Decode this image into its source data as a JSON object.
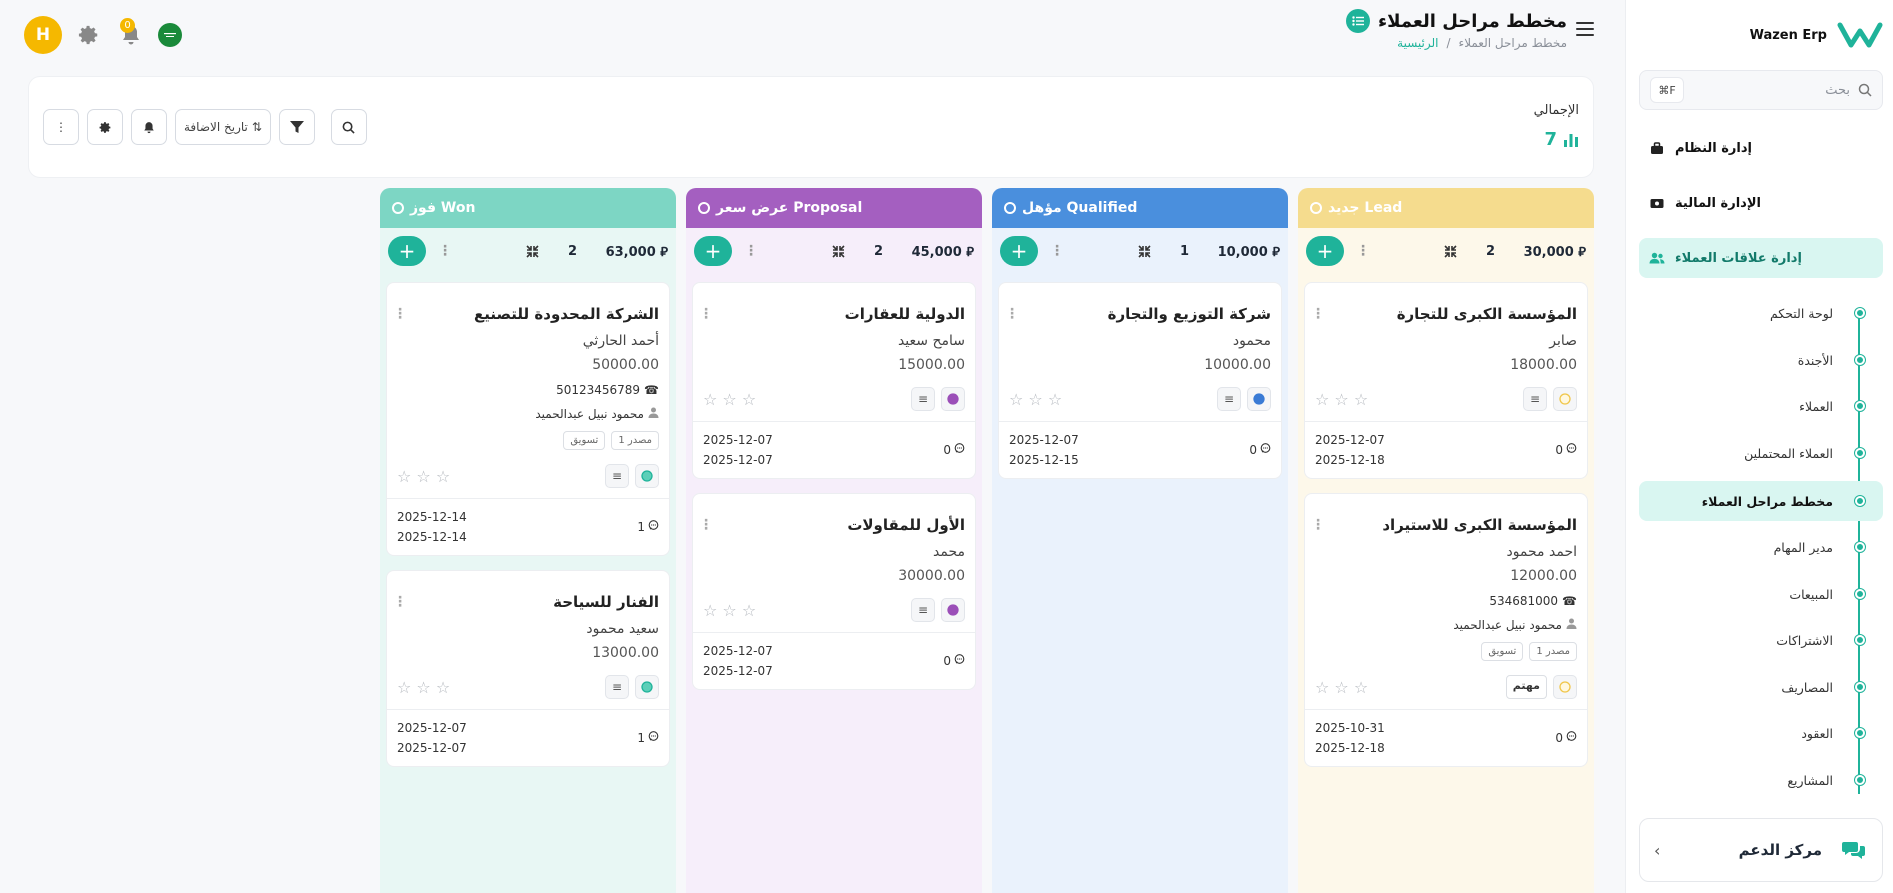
{
  "sidebar": {
    "brand": "Wazen Erp",
    "search_placeholder": "بحث",
    "shortcut": "⌘F",
    "sections": [
      {
        "label": "إدارة النظام"
      },
      {
        "label": "الإدارة المالية"
      },
      {
        "label": "إدارة علاقات العملاء"
      }
    ],
    "items": [
      {
        "label": "لوحة التحكم"
      },
      {
        "label": "الأجندة"
      },
      {
        "label": "العملاء"
      },
      {
        "label": "العملاء المحتملين"
      },
      {
        "label": "مخطط مراحل العملاء"
      },
      {
        "label": "مدير المهام"
      },
      {
        "label": "المبيعات"
      },
      {
        "label": "الاشتراكات"
      },
      {
        "label": "المصاريف"
      },
      {
        "label": "العقود"
      },
      {
        "label": "المشاريع"
      }
    ],
    "support": "مركز الدعم"
  },
  "header": {
    "title": "مخطط مراحل العملاء",
    "breadcrumb": {
      "home": "الرئيسية",
      "sep": "/",
      "current": "مخطط مراحل العملاء"
    },
    "avatar": "H",
    "notifications": "0",
    "flag": "KSA"
  },
  "toolbar": {
    "total_label": "الإجمالي",
    "total_value": "7",
    "sort_label": "تاريخ الاضافة"
  },
  "colors": {
    "accent": "#1fb39a",
    "lead": "#f5dc8e",
    "qualified": "#4a8fdd",
    "proposal": "#a45fc0",
    "won": "#7dd6c4"
  },
  "columns": [
    {
      "key": "lead",
      "name": "Lead جديد",
      "amount": "30,000 ⃁",
      "count": "2",
      "cards": [
        {
          "title": "المؤسسة الكبرى للتجارة",
          "contact": "صابر",
          "amount": "18000.00",
          "phone": "",
          "owner": "",
          "tags": [],
          "priority": "",
          "dates": [
            "2025-12-07",
            "2025-12-18"
          ],
          "comments": "0"
        },
        {
          "title": "المؤسسة الكبرى للاستيراد",
          "contact": "احمد محمود",
          "amount": "12000.00",
          "phone": "534681000",
          "owner": "محمود نبيل عبدالحميد",
          "tags": [
            "مصدر 1",
            "تسويق"
          ],
          "priority": "مهتم",
          "dates": [
            "2025-10-31",
            "2025-12-18"
          ],
          "comments": "0"
        }
      ]
    },
    {
      "key": "qualified",
      "name": "Qualified مؤهل",
      "amount": "10,000 ⃁",
      "count": "1",
      "cards": [
        {
          "title": "شركة التوزيع والتجارة",
          "contact": "محمود",
          "amount": "10000.00",
          "phone": "",
          "owner": "",
          "tags": [],
          "priority": "",
          "dates": [
            "2025-12-07",
            "2025-12-15"
          ],
          "comments": "0"
        }
      ]
    },
    {
      "key": "proposal",
      "name": "Proposal عرض سعر",
      "amount": "45,000 ⃁",
      "count": "2",
      "cards": [
        {
          "title": "الدولية للعقارات",
          "contact": "سامح سعيد",
          "amount": "15000.00",
          "phone": "",
          "owner": "",
          "tags": [],
          "priority": "",
          "dates": [
            "2025-12-07",
            "2025-12-07"
          ],
          "comments": "0"
        },
        {
          "title": "الأول للمقاولات",
          "contact": "محمد",
          "amount": "30000.00",
          "phone": "",
          "owner": "",
          "tags": [],
          "priority": "",
          "dates": [
            "2025-12-07",
            "2025-12-07"
          ],
          "comments": "0"
        }
      ]
    },
    {
      "key": "won",
      "name": "Won فوز",
      "amount": "63,000 ⃁",
      "count": "2",
      "cards": [
        {
          "title": "الشركة المحدودة للتصنيع",
          "contact": "أحمد الحارثي",
          "amount": "50000.00",
          "phone": "50123456789",
          "owner": "محمود نبيل عبدالحميد",
          "tags": [
            "مصدر 1",
            "تسويق"
          ],
          "priority": "",
          "dates": [
            "2025-12-14",
            "2025-12-14"
          ],
          "comments": "1"
        },
        {
          "title": "الفنار للسياحة",
          "contact": "سعيد محمود",
          "amount": "13000.00",
          "phone": "",
          "owner": "",
          "tags": [],
          "priority": "",
          "dates": [
            "2025-12-07",
            "2025-12-07"
          ],
          "comments": "1"
        }
      ]
    }
  ]
}
